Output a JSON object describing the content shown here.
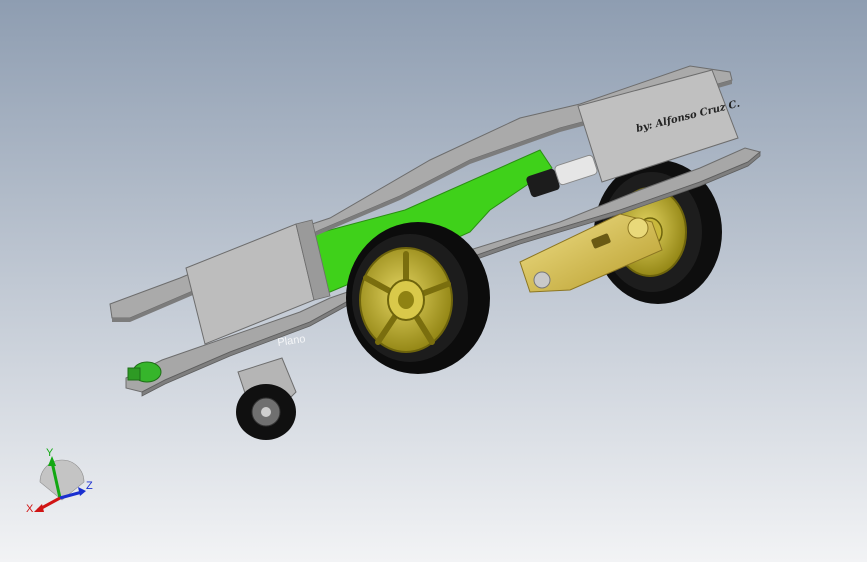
{
  "viewport": {
    "background_top": "#8e9db1",
    "background_bottom": "#f2f3f5"
  },
  "model": {
    "signature_text": "by: Alfonso Cruz C.",
    "plane_label": "Plano",
    "colors": {
      "chassis": "#a9a9a9",
      "chassis_light": "#c8c8c8",
      "chassis_dark": "#8b8b8b",
      "battery": "#3fd11a",
      "battery_dark": "#2fa315",
      "wheel_rim": "#a89a16",
      "wheel_rim_light": "#d4c43a",
      "tire": "#111111",
      "motor_gear": "#d7c04c",
      "caster_bracket": "#b3b3b3",
      "switch": "#36b52b"
    }
  },
  "triad": {
    "x_label": "X",
    "y_label": "Y",
    "z_label": "Z",
    "x_color": "#d01414",
    "y_color": "#12a812",
    "z_color": "#1a2fd0"
  }
}
